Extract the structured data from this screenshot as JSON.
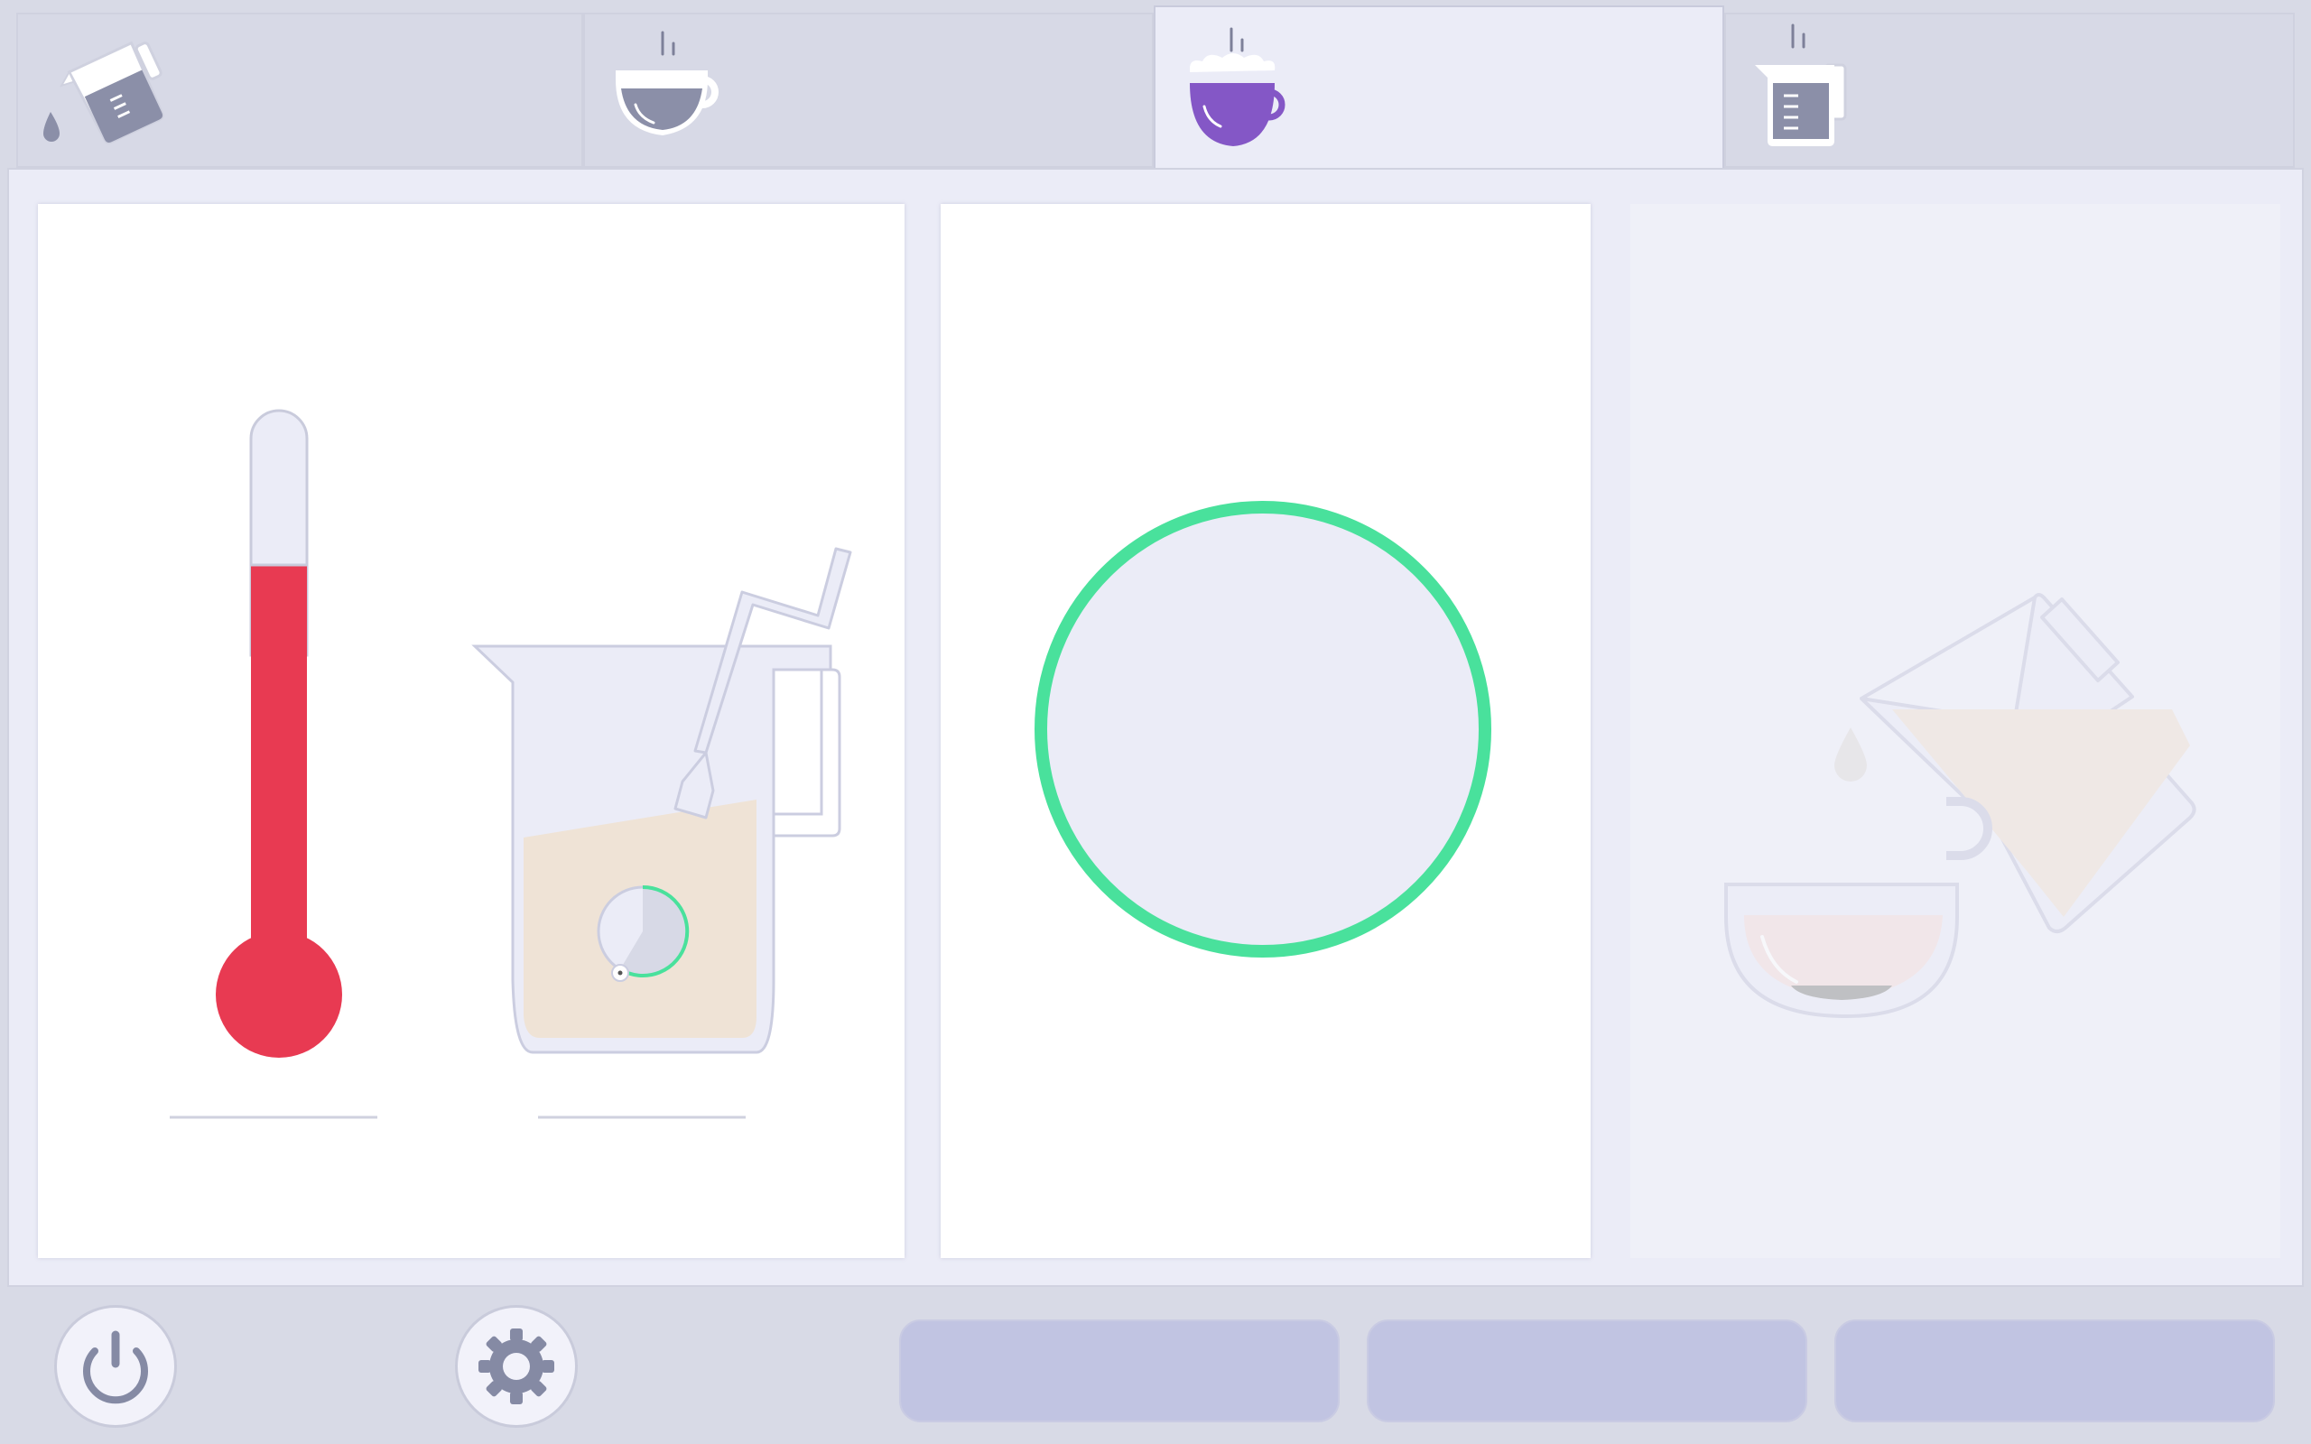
{
  "tabs": [
    {
      "name": "pour-jug-tab",
      "icon": "pouring-measuring-jug-icon",
      "active": false
    },
    {
      "name": "espresso-cup-tab",
      "icon": "hot-cup-icon",
      "active": false
    },
    {
      "name": "frothy-cup-tab",
      "icon": "frothy-hot-cup-icon",
      "active": true
    },
    {
      "name": "hot-jug-tab",
      "icon": "hot-measuring-jug-icon",
      "active": false
    }
  ],
  "cards": {
    "heating": {
      "icons": [
        "thermometer-icon",
        "milk-jug-icon",
        "timer-icon"
      ],
      "temperature_level": 0.72
    },
    "progress": {
      "icon": "progress-ring-icon",
      "progress": 1.0
    },
    "pour": {
      "icons": [
        "pouring-jug-icon",
        "cup-icon",
        "drop-icon"
      ],
      "disabled": true
    }
  },
  "footer": {
    "buttons": [
      "power-icon",
      "gear-icon"
    ],
    "actions": [
      "",
      "",
      ""
    ]
  },
  "colors": {
    "accent": "#8457c6",
    "thermometer": "#e83a52",
    "progress": "#49e19c",
    "milk": "#efe3d6",
    "panel": "#ebecf7"
  }
}
